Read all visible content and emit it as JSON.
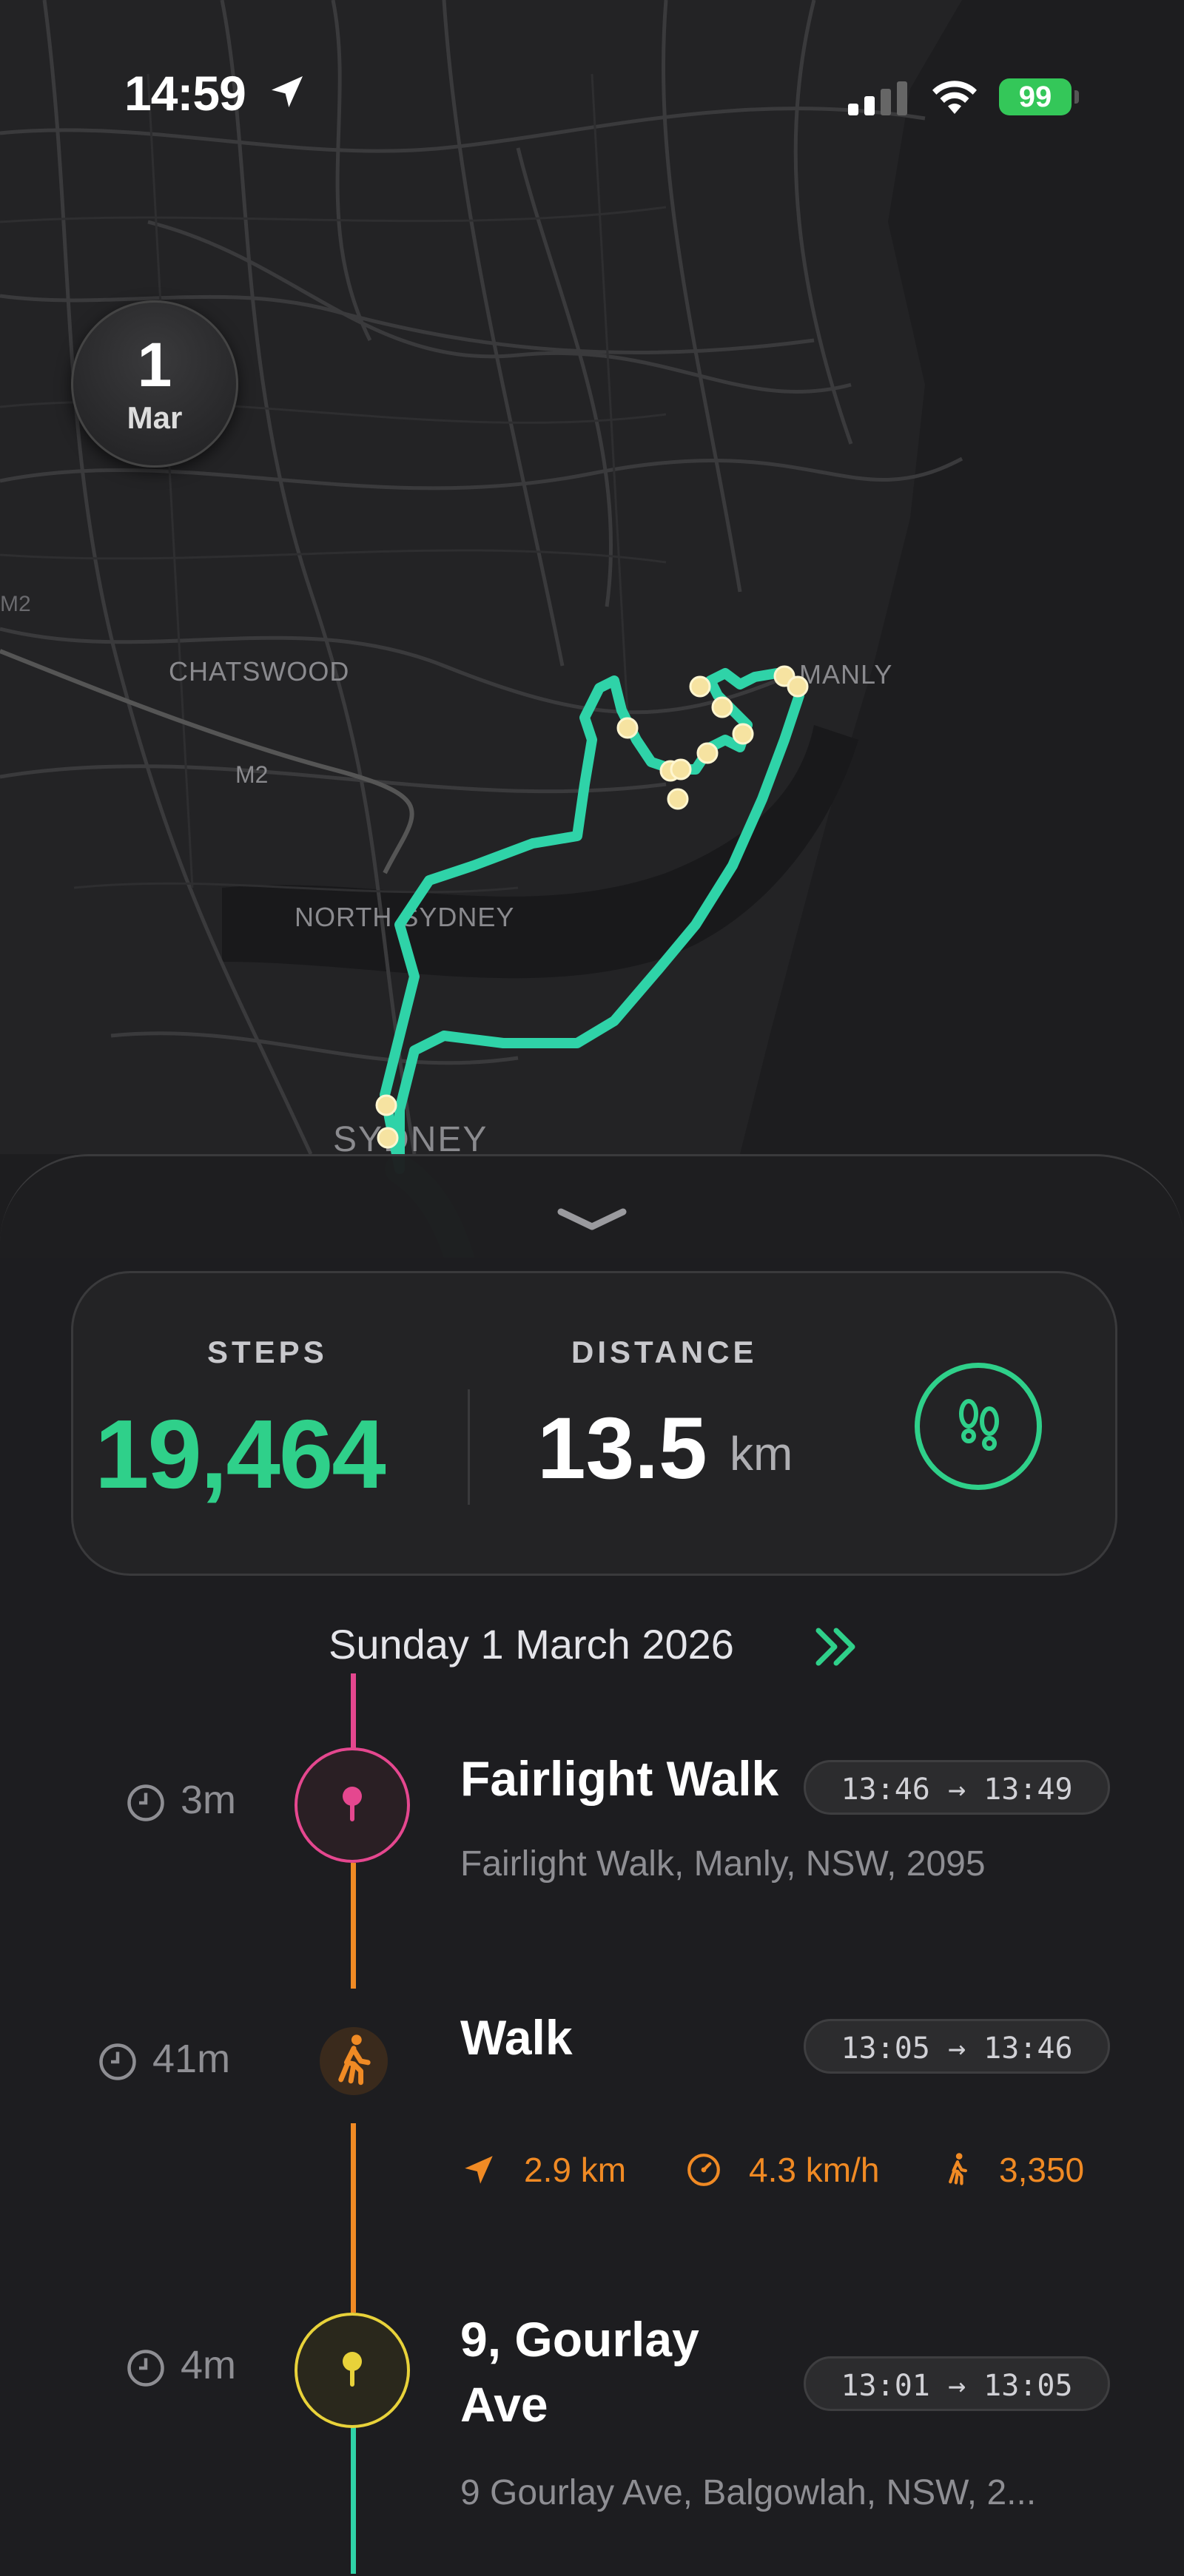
{
  "status_bar": {
    "time": "14:59",
    "battery": "99"
  },
  "date_badge": {
    "day": "1",
    "month": "Mar"
  },
  "map": {
    "labels": [
      "CHATSWOOD",
      "M2",
      "NORTH SYDNEY",
      "SYDNEY",
      "MANLY",
      "M2"
    ],
    "route_color": "#2fd3a8"
  },
  "stats": {
    "steps_label": "STEPS",
    "steps_value": "19,464",
    "distance_label": "DISTANCE",
    "distance_value": "13.5",
    "distance_unit": "km",
    "accent": "#2fd08a"
  },
  "timeline": {
    "heading": "Sunday 1 March 2026",
    "items": [
      {
        "duration": "3m",
        "title": "Fairlight Walk",
        "time_range": "13:46 → 13:49",
        "subtitle": "Fairlight Walk, Manly, NSW, 2095",
        "color": "#e5478f"
      },
      {
        "duration": "41m",
        "title": "Walk",
        "time_range": "13:05 → 13:46",
        "distance": "2.9 km",
        "speed": "4.3 km/h",
        "steps": "3,350",
        "color": "#f08a24"
      },
      {
        "duration": "4m",
        "title_line1": "9, Gourlay",
        "title_line2": "Ave",
        "time_range": "13:01 → 13:05",
        "subtitle": "9 Gourlay Ave, Balgowlah, NSW, 2...",
        "color": "#e8d23a"
      }
    ]
  }
}
